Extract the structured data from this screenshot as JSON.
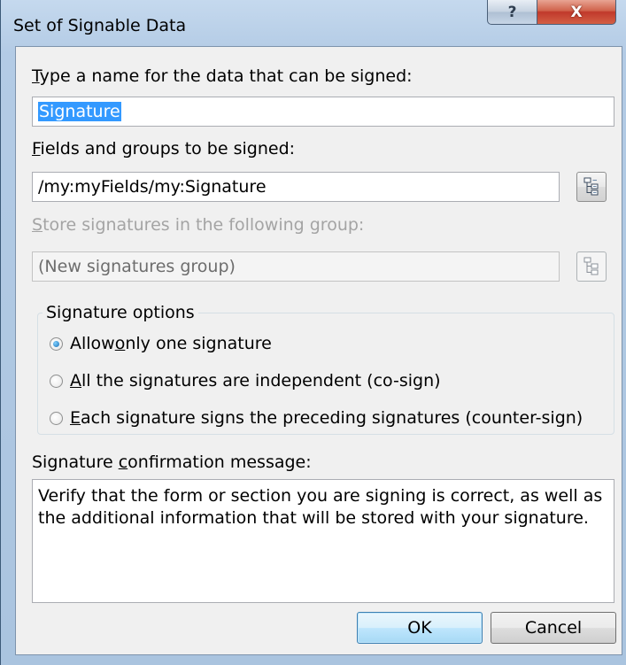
{
  "window": {
    "title": "Set of Signable Data",
    "help_label": "?",
    "close_label": "X"
  },
  "name_field": {
    "label_accel": "T",
    "label_rest": "ype a name for the data that can be signed:",
    "value": "Signature"
  },
  "fields_field": {
    "label_accel": "F",
    "label_rest": "ields and groups to be signed:",
    "value": "/my:myFields/my:Signature"
  },
  "store_field": {
    "label_accel": "S",
    "label_rest": "tore signatures in the following group:",
    "value": "(New signatures group)",
    "enabled": false
  },
  "signature_options": {
    "legend": "Signature options",
    "options": [
      {
        "pre": "Allow ",
        "accel": "o",
        "post": "nly one signature",
        "checked": true
      },
      {
        "pre": "",
        "accel": "A",
        "post": "ll the signatures are independent (co-sign)",
        "checked": false
      },
      {
        "pre": "",
        "accel": "E",
        "post": "ach signature signs the preceding signatures (counter-sign)",
        "checked": false
      }
    ]
  },
  "confirmation": {
    "label_pre": "Signature ",
    "label_accel": "c",
    "label_post": "onfirmation message:",
    "message": "Verify that the form or section you are signing is correct, as well as the additional information that will be stored with your signature."
  },
  "buttons": {
    "ok": "OK",
    "cancel": "Cancel"
  },
  "icons": {
    "tree_icon": "tree-view-icon",
    "help_icon": "help-icon",
    "close_icon": "close-icon"
  }
}
